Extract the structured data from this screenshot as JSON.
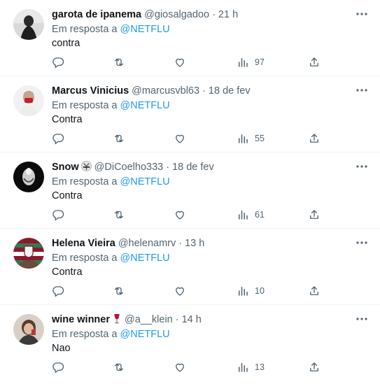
{
  "colors": {
    "text": "#0f1419",
    "secondary": "#536471",
    "link": "#1d9bf0",
    "divider": "#eff3f4"
  },
  "icons": {
    "reply": "reply-icon",
    "repost": "repost-icon",
    "like": "like-icon",
    "views": "views-icon",
    "share": "share-icon",
    "more": "more-icon"
  },
  "tweets": [
    {
      "name": "garota de ipanema",
      "handle": "@giosalgadoo",
      "dot": "·",
      "time": "21 h",
      "reply_prefix": "Em resposta a",
      "reply_to": "@NETFLU",
      "text": "contra",
      "views": "97"
    },
    {
      "name": "Marcus Vinicius",
      "handle": "@marcusvbl63",
      "dot": "·",
      "time": "18 de fev",
      "reply_prefix": "Em resposta a",
      "reply_to": "@NETFLU",
      "text": "Contra",
      "views": "55"
    },
    {
      "name": "Snow",
      "emoji": "karate-gi-emoji",
      "handle": "@DiCoelho333",
      "dot": "·",
      "time": "18 de fev",
      "reply_prefix": "Em resposta a",
      "reply_to": "@NETFLU",
      "text": "Contra",
      "views": "61"
    },
    {
      "name": "Helena Vieira",
      "handle": "@helenamrv",
      "dot": "·",
      "time": "13 h",
      "reply_prefix": "Em resposta a",
      "reply_to": "@NETFLU",
      "text": "Contra",
      "views": "10"
    },
    {
      "name": "wine winner",
      "emoji": "wine-glass-emoji",
      "handle": "@a__klein",
      "dot": "·",
      "time": "14 h",
      "reply_prefix": "Em resposta a",
      "reply_to": "@NETFLU",
      "text": "Nao",
      "views": "13"
    }
  ]
}
